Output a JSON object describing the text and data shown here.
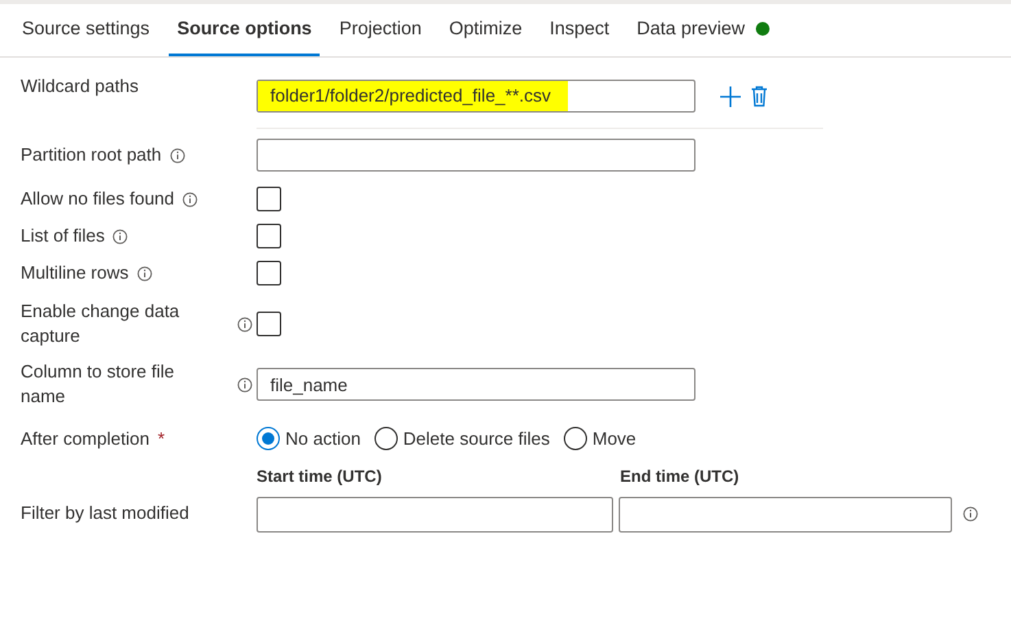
{
  "tabs": [
    {
      "label": "Source settings",
      "selected": false
    },
    {
      "label": "Source options",
      "selected": true
    },
    {
      "label": "Projection",
      "selected": false
    },
    {
      "label": "Optimize",
      "selected": false
    },
    {
      "label": "Inspect",
      "selected": false
    },
    {
      "label": "Data preview",
      "selected": false,
      "status_dot": true
    }
  ],
  "fields": [
    {
      "kind": "wildcard",
      "label": "Wildcard paths",
      "value": "folder1/folder2/predicted_file_**.csv",
      "highlighted": true
    },
    {
      "kind": "text",
      "label": "Partition root path",
      "info": true
    },
    {
      "kind": "checkbox",
      "label": "Allow no files found",
      "info": true,
      "checked": false
    },
    {
      "kind": "checkbox",
      "label": "List of files",
      "info": true,
      "checked": false
    },
    {
      "kind": "checkbox",
      "label": "Multiline rows",
      "info": true,
      "checked": false
    },
    {
      "kind": "checkbox",
      "label": "Enable change data capture",
      "info": true,
      "label_wraps": true,
      "checked": false
    },
    {
      "kind": "text",
      "label": "Column to store file name",
      "info": true,
      "label_wraps": true,
      "value": "file_name"
    },
    {
      "kind": "radio",
      "label": "After completion",
      "required": "*",
      "options": [
        {
          "label": "No action",
          "selected": true
        },
        {
          "label": "Delete source files",
          "selected": false
        },
        {
          "label": "Move",
          "selected": false
        }
      ]
    },
    {
      "kind": "daterange",
      "label": "Filter by last modified",
      "start_label": "Start time (UTC)",
      "end_label": "End time (UTC)",
      "info": true
    }
  ]
}
